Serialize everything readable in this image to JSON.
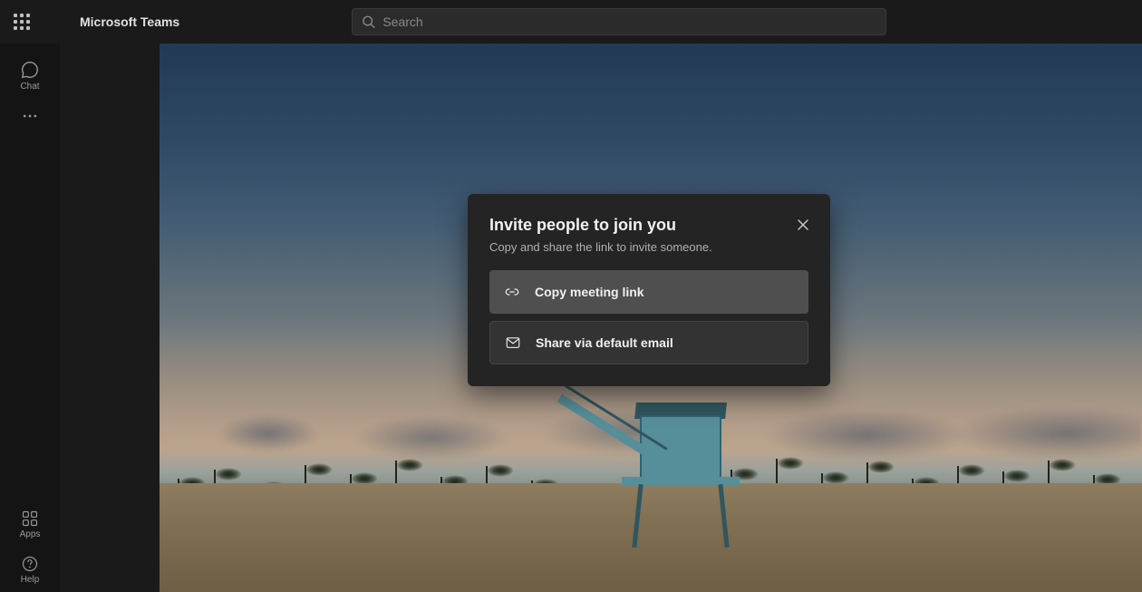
{
  "header": {
    "app_title": "Microsoft Teams",
    "search_placeholder": "Search"
  },
  "leftrail": {
    "chat_label": "Chat",
    "apps_label": "Apps",
    "help_label": "Help"
  },
  "modal": {
    "title": "Invite people to join you",
    "subtitle": "Copy and share the link to invite someone.",
    "copy_link_label": "Copy meeting link",
    "share_email_label": "Share via default email"
  }
}
